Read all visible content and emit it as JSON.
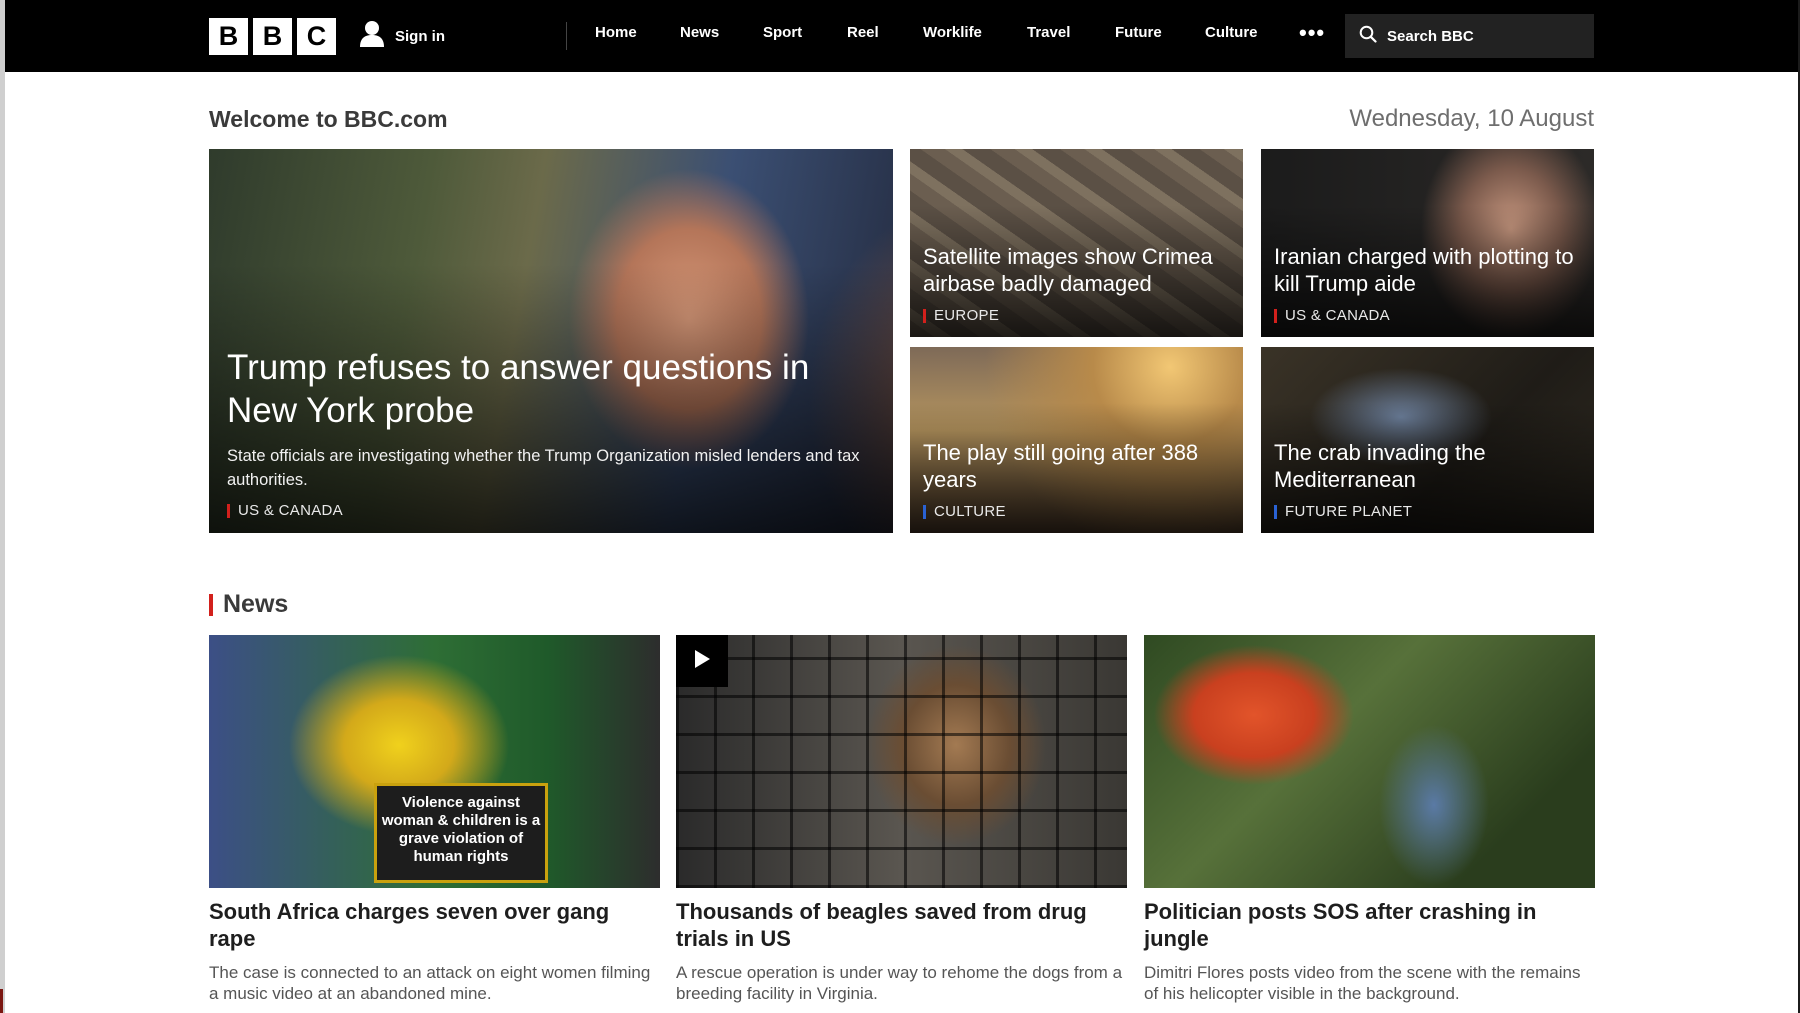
{
  "nav": {
    "logo": [
      "B",
      "B",
      "C"
    ],
    "signin_label": "Sign in",
    "items": [
      "Home",
      "News",
      "Sport",
      "Reel",
      "Worklife",
      "Travel",
      "Future",
      "Culture"
    ],
    "more_label": "•••",
    "search_placeholder": "Search BBC"
  },
  "header": {
    "welcome": "Welcome to BBC.com",
    "date": "Wednesday, 10 August"
  },
  "hero": {
    "main": {
      "headline": "Trump refuses to answer questions in New York probe",
      "summary": "State officials are investigating whether the Trump Organization misled lenders and tax authorities.",
      "tag": "US & CANADA"
    },
    "tiles": [
      {
        "headline": "Satellite images show Crimea airbase badly damaged",
        "tag": "EUROPE",
        "tag_color": "#d2201c"
      },
      {
        "headline": "Iranian charged with plotting to kill Trump aide",
        "tag": "US & CANADA",
        "tag_color": "#d2201c"
      },
      {
        "headline": "The play still going after 388 years",
        "tag": "CULTURE",
        "tag_color": "#2a62d4"
      },
      {
        "headline": "The crab invading the Mediterranean",
        "tag": "FUTURE PLANET",
        "tag_color": "#2a62d4"
      }
    ]
  },
  "news": {
    "section_title": "News",
    "cards": [
      {
        "title": "South Africa charges seven over gang rape",
        "desc": "The case is connected to an attack on eight women filming a music video at an abandoned mine.",
        "image_sign": "Violence against woman & children is a grave violation of human rights"
      },
      {
        "title": "Thousands of beagles saved from drug trials in US",
        "desc": "A rescue operation is under way to rehome the dogs from a breeding facility in Virginia."
      },
      {
        "title": "Politician posts SOS after crashing in jungle",
        "desc": "Dimitri Flores posts video from the scene with the remains of his helicopter visible in the background."
      }
    ]
  },
  "colors": {
    "nav_bg": "#000000",
    "accent_red": "#d2201c",
    "accent_blue": "#2a62d4"
  }
}
